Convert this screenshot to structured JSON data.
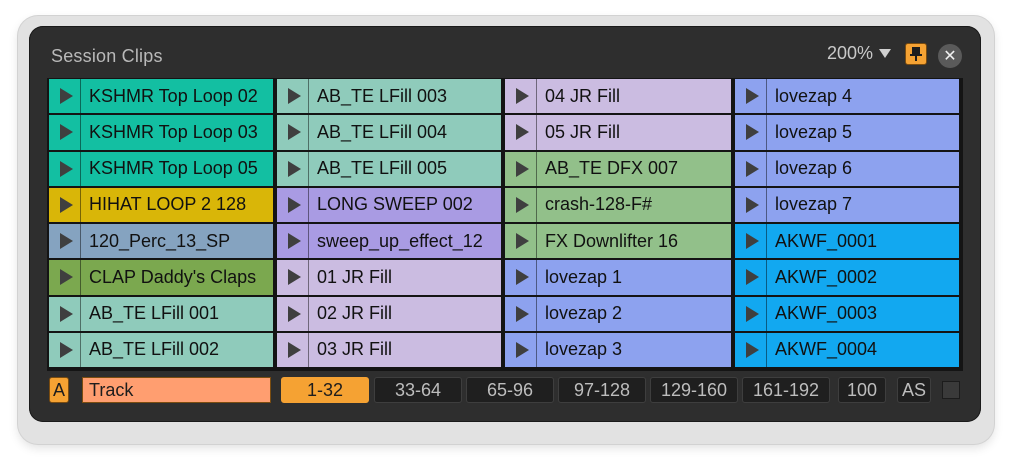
{
  "window": {
    "title": "Session Clips",
    "zoom": "200%",
    "pin_icon": "pin-icon",
    "close_icon": "close-icon",
    "close_glyph": "✕"
  },
  "colors": {
    "accent_orange": "#f5a233",
    "track_field": "#ff9e70"
  },
  "columns": [
    [
      {
        "label": "KSHMR Top Loop 02",
        "color": "#13bfa2"
      },
      {
        "label": "KSHMR Top Loop 03",
        "color": "#13bfa2"
      },
      {
        "label": "KSHMR Top Loop 05",
        "color": "#13bfa2"
      },
      {
        "label": "HIHAT LOOP 2  128",
        "color": "#d9b608"
      },
      {
        "label": "120_Perc_13_SP",
        "color": "#85a3c0"
      },
      {
        "label": "CLAP Daddy's Claps",
        "color": "#7ba84f"
      },
      {
        "label": "AB_TE LFill 001",
        "color": "#8fcbbb"
      },
      {
        "label": "AB_TE LFill 002",
        "color": "#8fcbbb"
      }
    ],
    [
      {
        "label": "AB_TE LFill 003",
        "color": "#8fcbbb"
      },
      {
        "label": "AB_TE LFill 004",
        "color": "#8fcbbb"
      },
      {
        "label": "AB_TE LFill 005",
        "color": "#8fcbbb"
      },
      {
        "label": "LONG SWEEP 002",
        "color": "#a99be3"
      },
      {
        "label": "sweep_up_effect_12",
        "color": "#a99be3"
      },
      {
        "label": "01 JR Fill",
        "color": "#cbbce1"
      },
      {
        "label": "02 JR Fill",
        "color": "#cbbce1"
      },
      {
        "label": "03 JR Fill",
        "color": "#cbbce1"
      }
    ],
    [
      {
        "label": "04 JR Fill",
        "color": "#cbbce1"
      },
      {
        "label": "05 JR Fill",
        "color": "#cbbce1"
      },
      {
        "label": "AB_TE DFX 007",
        "color": "#92c08a"
      },
      {
        "label": "crash-128-F#",
        "color": "#92c08a"
      },
      {
        "label": "FX Downlifter 16",
        "color": "#92c08a"
      },
      {
        "label": "lovezap 1",
        "color": "#8da2ef"
      },
      {
        "label": "lovezap 2",
        "color": "#8da2ef"
      },
      {
        "label": "lovezap 3",
        "color": "#8da2ef"
      }
    ],
    [
      {
        "label": "lovezap 4",
        "color": "#8da2ef"
      },
      {
        "label": "lovezap 5",
        "color": "#8da2ef"
      },
      {
        "label": "lovezap 6",
        "color": "#8da2ef"
      },
      {
        "label": "lovezap 7",
        "color": "#8da2ef"
      },
      {
        "label": "AKWF_0001",
        "color": "#12a8f0"
      },
      {
        "label": "AKWF_0002",
        "color": "#12a8f0"
      },
      {
        "label": "AKWF_0003",
        "color": "#12a8f0"
      },
      {
        "label": "AKWF_0004",
        "color": "#12a8f0"
      }
    ]
  ],
  "footer": {
    "a_button": "A",
    "track_field": "Track",
    "pages": [
      "1-32",
      "33-64",
      "65-96",
      "97-128",
      "129-160",
      "161-192"
    ],
    "active_page": "1-32",
    "value_button": "100",
    "as_button": "AS"
  }
}
